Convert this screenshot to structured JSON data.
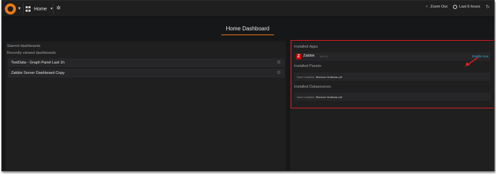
{
  "navbar": {
    "dashboard_title": "Home",
    "zoom_label": "Zoom Out",
    "time_range": "Last 6 hours",
    "icons": {
      "logo": "grafana-logo",
      "dashboards": "grid-icon",
      "settings": "gear-icon",
      "zoom": "chevron-left-icon",
      "time": "clock-icon",
      "refresh": "refresh-icon"
    }
  },
  "page": {
    "title": "Home Dashboard"
  },
  "left": {
    "starred_heading": "Starred dashboards",
    "recent_heading": "Recently viewed dashboards",
    "dashboards": [
      {
        "label": "TestData - Graph Panel Last 1h"
      },
      {
        "label": "Zabbix Server Dashboard Copy"
      }
    ]
  },
  "right": {
    "apps_heading": "Installed Apps",
    "app": {
      "badge": "Z",
      "name": "Zabbix",
      "version": "v3.2.0",
      "enable_label": "Enable now"
    },
    "panels_heading": "Installed Panels",
    "panels_empty_prefix": "None installed.",
    "panels_browse": "Browse Grafana.net",
    "datasources_heading": "Installed Datasources",
    "datasources_empty_prefix": "None installed.",
    "datasources_browse": "Browse Grafana.net"
  },
  "colors": {
    "accent": "#eb7b18",
    "highlight": "#e02020",
    "link": "#33b5e5",
    "zabbix": "#d40000"
  }
}
